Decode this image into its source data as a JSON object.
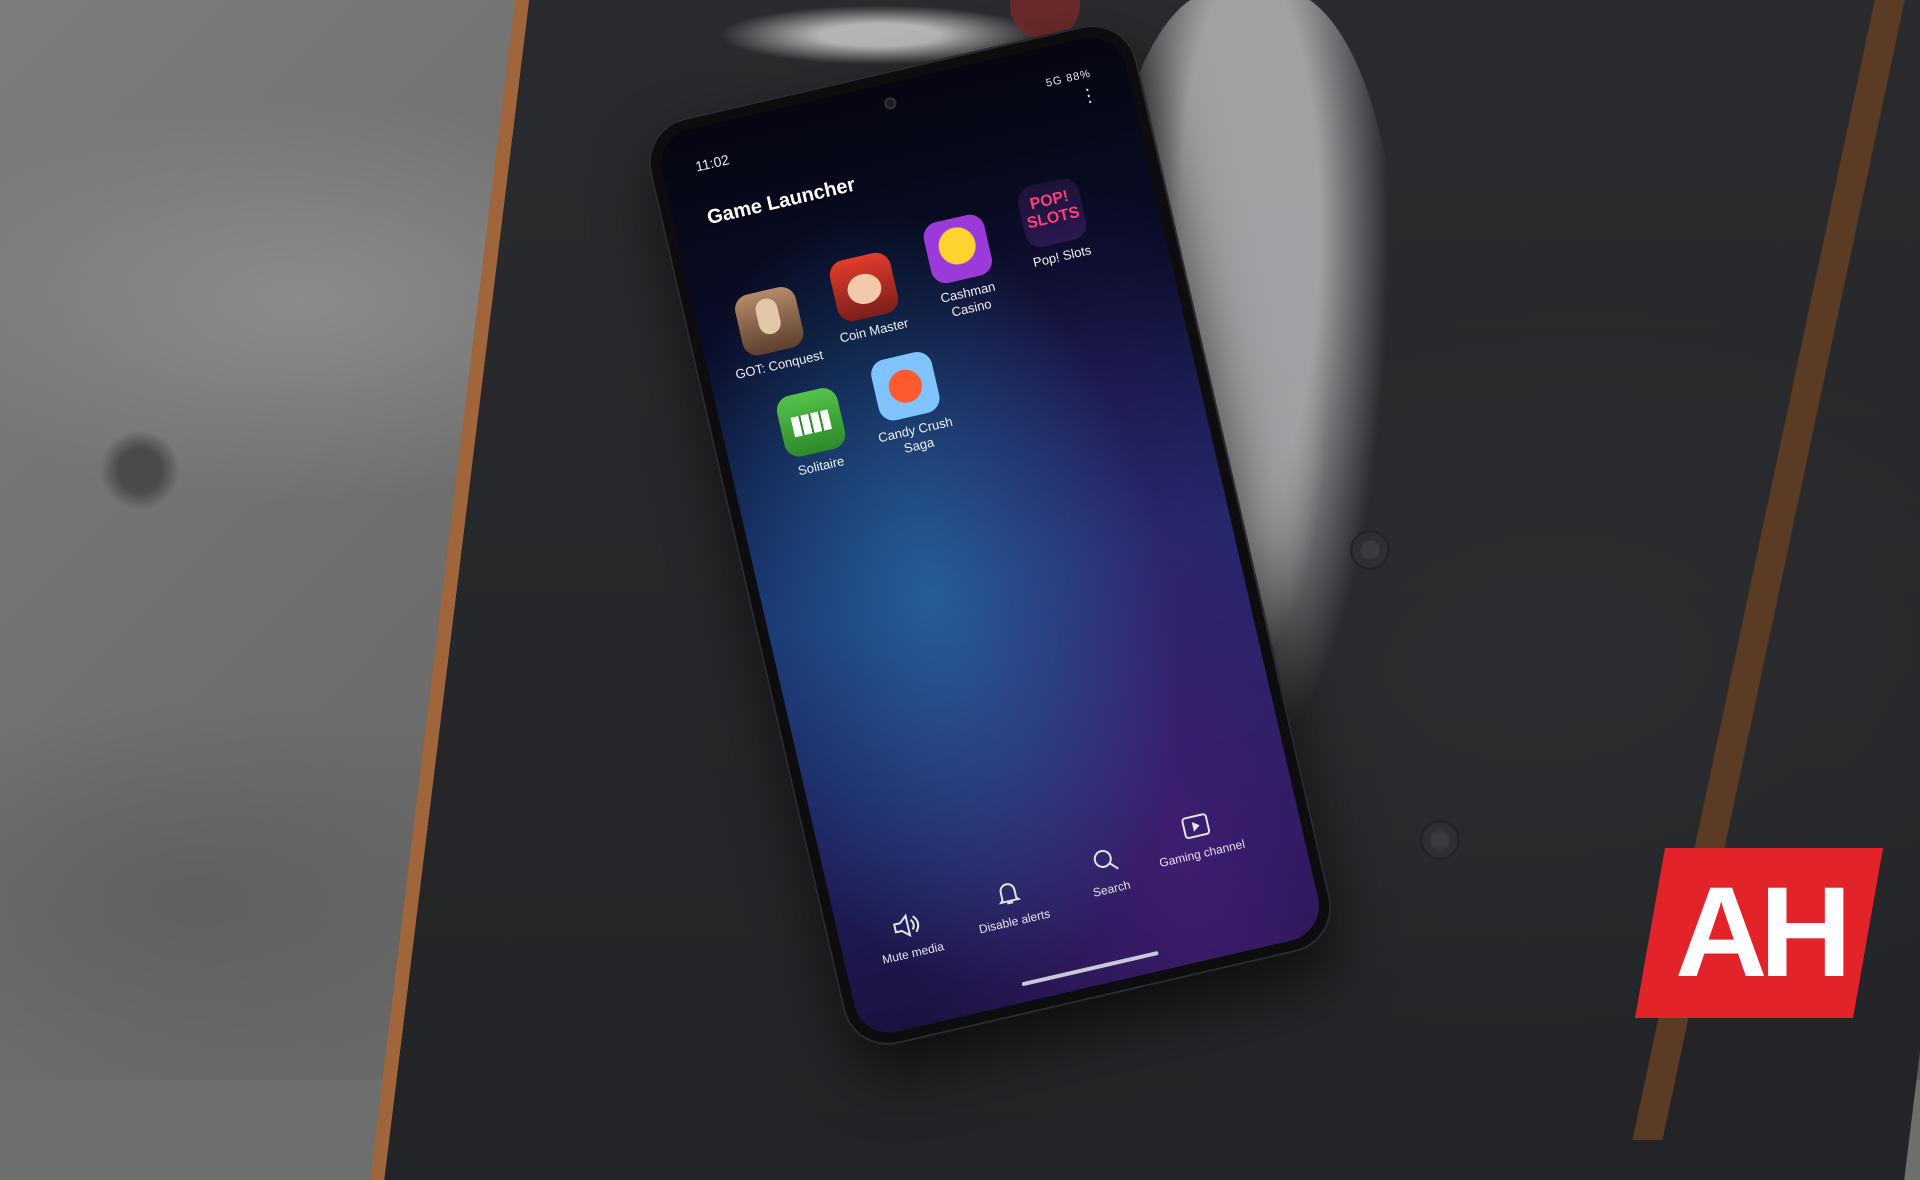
{
  "status": {
    "time": "11:02",
    "indicators": "5G 88%"
  },
  "screen": {
    "title": "Game Launcher",
    "apps": [
      {
        "label": "GOT: Conquest",
        "icon": "got-conquest-icon"
      },
      {
        "label": "Coin Master",
        "icon": "coin-master-icon"
      },
      {
        "label": "Cashman Casino",
        "icon": "cashman-casino-icon"
      },
      {
        "label": "Pop! Slots",
        "icon": "pop-slots-icon"
      },
      {
        "label": "Solitaire",
        "icon": "solitaire-icon"
      },
      {
        "label": "Candy Crush Saga",
        "icon": "candy-crush-icon"
      }
    ],
    "pop_icon_text": "POP! SLOTS",
    "toolbar": {
      "mute": "Mute media",
      "alerts": "Disable alerts",
      "search": "Search",
      "channel": "Gaming channel"
    }
  },
  "watermark": {
    "text": "AH",
    "color": "#e3232a"
  }
}
